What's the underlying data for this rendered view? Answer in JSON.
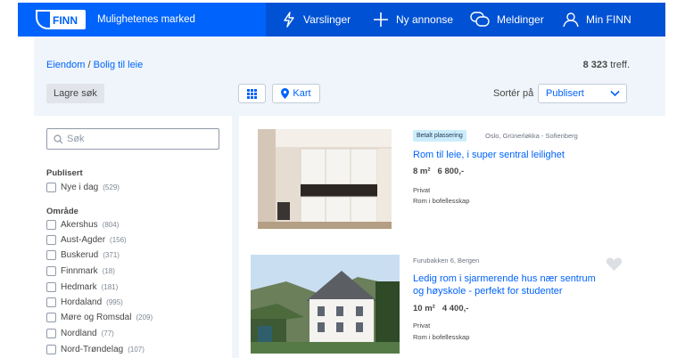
{
  "header": {
    "logo_text": "FINN",
    "tagline": "Mulighetenes marked",
    "nav": [
      {
        "label": "Varslinger",
        "icon": "bolt-icon"
      },
      {
        "label": "Ny annonse",
        "icon": "plus-icon"
      },
      {
        "label": "Meldinger",
        "icon": "chat-icon"
      },
      {
        "label": "Min FINN",
        "icon": "user-icon"
      }
    ]
  },
  "breadcrumb": {
    "part1": "Eiendom",
    "sep": "/",
    "part2": "Bolig til leie"
  },
  "hits": {
    "count": "8 323",
    "suffix": "treff."
  },
  "toolbar": {
    "save_search": "Lagre søk",
    "map_label": "Kart",
    "sort_label": "Sortér på",
    "sort_value": "Publisert"
  },
  "filter": {
    "search_placeholder": "Søk",
    "published_title": "Publisert",
    "published_items": [
      {
        "label": "Nye i dag",
        "count": "(529)"
      }
    ],
    "area_title": "Område",
    "area_items": [
      {
        "label": "Akershus",
        "count": "(804)"
      },
      {
        "label": "Aust-Agder",
        "count": "(156)"
      },
      {
        "label": "Buskerud",
        "count": "(371)"
      },
      {
        "label": "Finnmark",
        "count": "(18)"
      },
      {
        "label": "Hedmark",
        "count": "(181)"
      },
      {
        "label": "Hordaland",
        "count": "(995)"
      },
      {
        "label": "Møre og Romsdal",
        "count": "(209)"
      },
      {
        "label": "Nordland",
        "count": "(77)"
      },
      {
        "label": "Nord-Trøndelag",
        "count": "(107)"
      }
    ]
  },
  "listings": [
    {
      "badge": "Betalt plassering",
      "location": "Oslo, Grünerløkka - Sofienberg",
      "title": "Rom til leie, i super sentral leilighet",
      "size": "8 m²",
      "price": "6 800,-",
      "seller": "Privat",
      "type": "Rom i bofellesskap"
    },
    {
      "location": "Furubakken 6, Bergen",
      "title_line1": "Ledig rom i sjarmerende hus nær sentrum",
      "title_line2": "og høyskole - perfekt for studenter",
      "size": "10 m²",
      "price": "4 400,-",
      "seller": "Privat",
      "type": "Rom i bofellesskap"
    }
  ],
  "colors": {
    "brand_blue": "#0063fb",
    "header_dark_blue": "#0051d4",
    "page_bg": "#eff5fb",
    "badge_bg": "#ccedfc"
  }
}
